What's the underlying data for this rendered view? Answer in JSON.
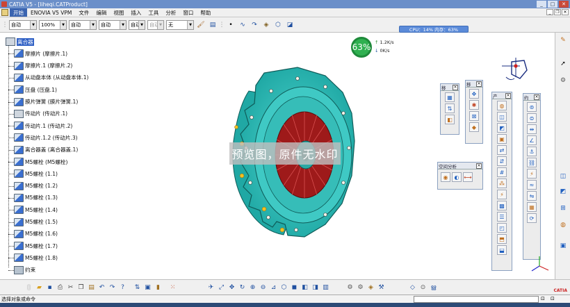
{
  "window": {
    "title": "CATIA V5 - [liheqi.CATProduct]",
    "buttons": [
      "_",
      "□",
      "✕"
    ]
  },
  "menubar": {
    "items": [
      "开始",
      "ENOVIA V5 VPM",
      "文件",
      "编辑",
      "视图",
      "插入",
      "工具",
      "分析",
      "窗口",
      "帮助"
    ],
    "active_index": 0
  },
  "toolbar_top": {
    "combos": [
      {
        "value": "自动",
        "disabled": false
      },
      {
        "value": "100%",
        "disabled": false
      },
      {
        "value": "自动",
        "disabled": false
      },
      {
        "value": "自动",
        "disabled": false
      },
      {
        "value": "自动",
        "disabled": false
      },
      {
        "value": "自动",
        "disabled": true
      },
      {
        "value": "无",
        "disabled": false
      }
    ]
  },
  "cpu": {
    "text": "CPU：14%  内存：63%"
  },
  "perf": {
    "percent": "63%",
    "up": "1.2K/s",
    "down": "0K/s"
  },
  "tree": {
    "items": [
      {
        "label": "离合器",
        "selected": true,
        "icon": "product"
      },
      {
        "label": "摩擦片 (摩擦片.1)",
        "icon": "part"
      },
      {
        "label": "摩擦片.1 (摩擦片.2)",
        "icon": "part"
      },
      {
        "label": "从动盘本体 (从动盘本体.1)",
        "icon": "part"
      },
      {
        "label": "压盘 (压盘.1)",
        "icon": "part"
      },
      {
        "label": "膜片弹簧 (膜片弹簧.1)",
        "icon": "part"
      },
      {
        "label": "传动片 (传动片.1)",
        "icon": "product"
      },
      {
        "label": "传动片.1 (传动片.2)",
        "icon": "part"
      },
      {
        "label": "传动片.1.2 (传动片.3)",
        "icon": "part"
      },
      {
        "label": "离合器盖 (离合器盖.1)",
        "icon": "part"
      },
      {
        "label": "M5螺栓 (M5螺栓)",
        "icon": "part"
      },
      {
        "label": "M5螺栓 (1.1)",
        "icon": "part"
      },
      {
        "label": "M5螺栓 (1.2)",
        "icon": "part"
      },
      {
        "label": "M5螺栓 (1.3)",
        "icon": "part"
      },
      {
        "label": "M5螺栓 (1.4)",
        "icon": "part"
      },
      {
        "label": "M5螺栓 (1.5)",
        "icon": "part"
      },
      {
        "label": "M5螺栓 (1.6)",
        "icon": "part"
      },
      {
        "label": "M5螺栓 (1.7)",
        "icon": "part"
      },
      {
        "label": "M5螺栓 (1.8)",
        "icon": "part"
      },
      {
        "label": "约束",
        "icon": "constraint"
      }
    ]
  },
  "watermark": {
    "text": "预览图，原件无水印"
  },
  "panels": [
    {
      "title": "移",
      "buttons": [
        "measure-icon",
        "move-icon",
        "snap-icon"
      ]
    },
    {
      "title": "移",
      "buttons": [
        "manipulate-icon",
        "explode-icon",
        "clash-icon",
        "smart-move-icon"
      ]
    },
    {
      "title": "产",
      "buttons": [
        "new-component-icon",
        "new-product-icon",
        "new-part-icon",
        "existing-component-icon",
        "replace-icon",
        "reorder-icon",
        "numbering-icon",
        "multi-instantiate-icon",
        "fast-instantiate-icon",
        "reuse-pattern-icon",
        "bill-icon",
        "scene-icon",
        "publish-icon",
        "flex-icon"
      ]
    },
    {
      "title": "约",
      "buttons": [
        "coincidence-icon",
        "contact-icon",
        "offset-icon",
        "angle-icon",
        "fix-icon",
        "fix-together-icon",
        "quick-constraint-icon",
        "flexible-icon",
        "change-constraint-icon",
        "reuse-pattern-icon",
        "update-icon"
      ]
    },
    {
      "title": "空间分析",
      "buttons": [
        "clash-analysis-icon",
        "sectioning-icon",
        "distance-icon"
      ]
    }
  ],
  "status": {
    "text": "选择对象或命令"
  },
  "brand": {
    "logo": "CATIA"
  }
}
